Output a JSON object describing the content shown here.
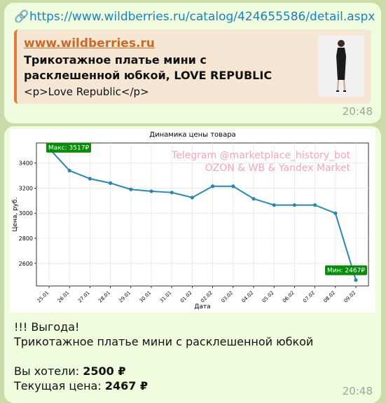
{
  "message1": {
    "url": "https://www.wildberries.ru/catalog/424655586/detail.aspx",
    "link_icon": "link-icon",
    "preview": {
      "site": "www.wildberries.ru",
      "title": "Трикотажное платье мини с расклешенной юбкой, LOVE REPUBLIC",
      "description": "<p>Love Republic</p>"
    },
    "time": "20:48"
  },
  "message2": {
    "line1": "!!! Выгода!",
    "line2": "Трикотажное платье мини с расклешенной юбкой",
    "wanted_label": "Вы хотели:",
    "wanted_value": "2500 ₽",
    "current_label": "Текущая цена:",
    "current_value": "2467 ₽",
    "time": "20:48"
  },
  "chart_data": {
    "type": "line",
    "title": "Динамика цены товара",
    "xlabel": "Дата",
    "ylabel": "Цена, руб.",
    "watermark_line1": "Telegram @marketplace_history_bot",
    "watermark_line2": "OZON & WB & Yandex Market",
    "categories": [
      "25.01",
      "26.01",
      "27.01",
      "28.01",
      "29.01",
      "30.01",
      "31.01",
      "01.02",
      "02.02",
      "03.02",
      "04.02",
      "05.02",
      "06.02",
      "07.02",
      "08.02",
      "09.02"
    ],
    "values": [
      3517,
      3340,
      3275,
      3240,
      3190,
      3175,
      3165,
      3125,
      3215,
      3215,
      3115,
      3065,
      3065,
      3065,
      3000,
      2467
    ],
    "yticks": [
      2600,
      2800,
      3000,
      3200,
      3400
    ],
    "ylim": [
      2420,
      3560
    ],
    "max_label": "Макс: 3517₽",
    "min_label": "Мин: 2467₽",
    "line_color": "#2e86ab",
    "label_color": "#0a8a0a",
    "grid": true
  }
}
